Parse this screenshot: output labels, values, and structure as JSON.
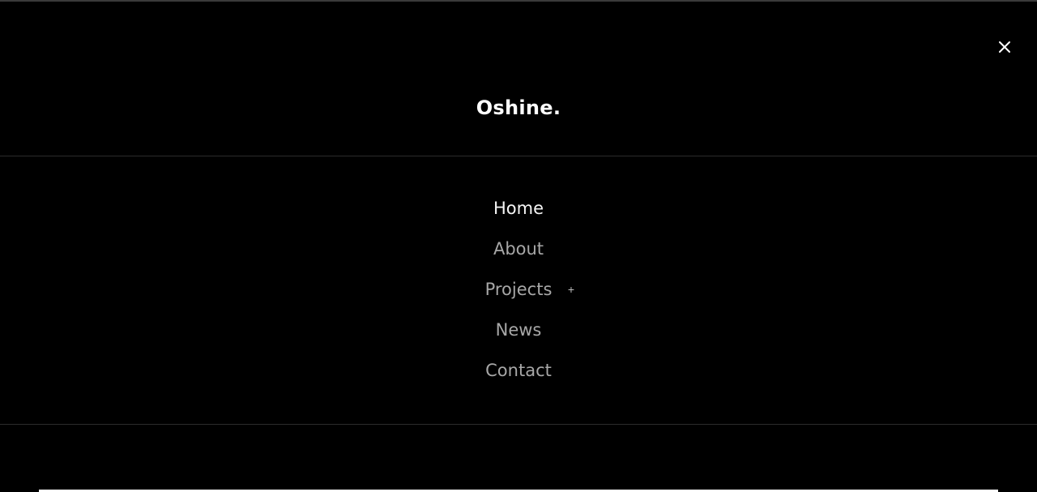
{
  "brand": {
    "logo_text": "Oshine."
  },
  "close": {
    "icon": "close-icon"
  },
  "nav": {
    "items": [
      {
        "label": "Home",
        "active": true
      },
      {
        "label": "About",
        "active": false
      },
      {
        "label": "Projects",
        "active": false,
        "submenu_toggle": "+"
      },
      {
        "label": "News",
        "active": false
      },
      {
        "label": "Contact",
        "active": false
      }
    ]
  },
  "colors": {
    "background": "#000000",
    "active_text": "#f5f5f5",
    "inactive_text": "#a7a7a7",
    "divider": "#2c2c2c"
  }
}
